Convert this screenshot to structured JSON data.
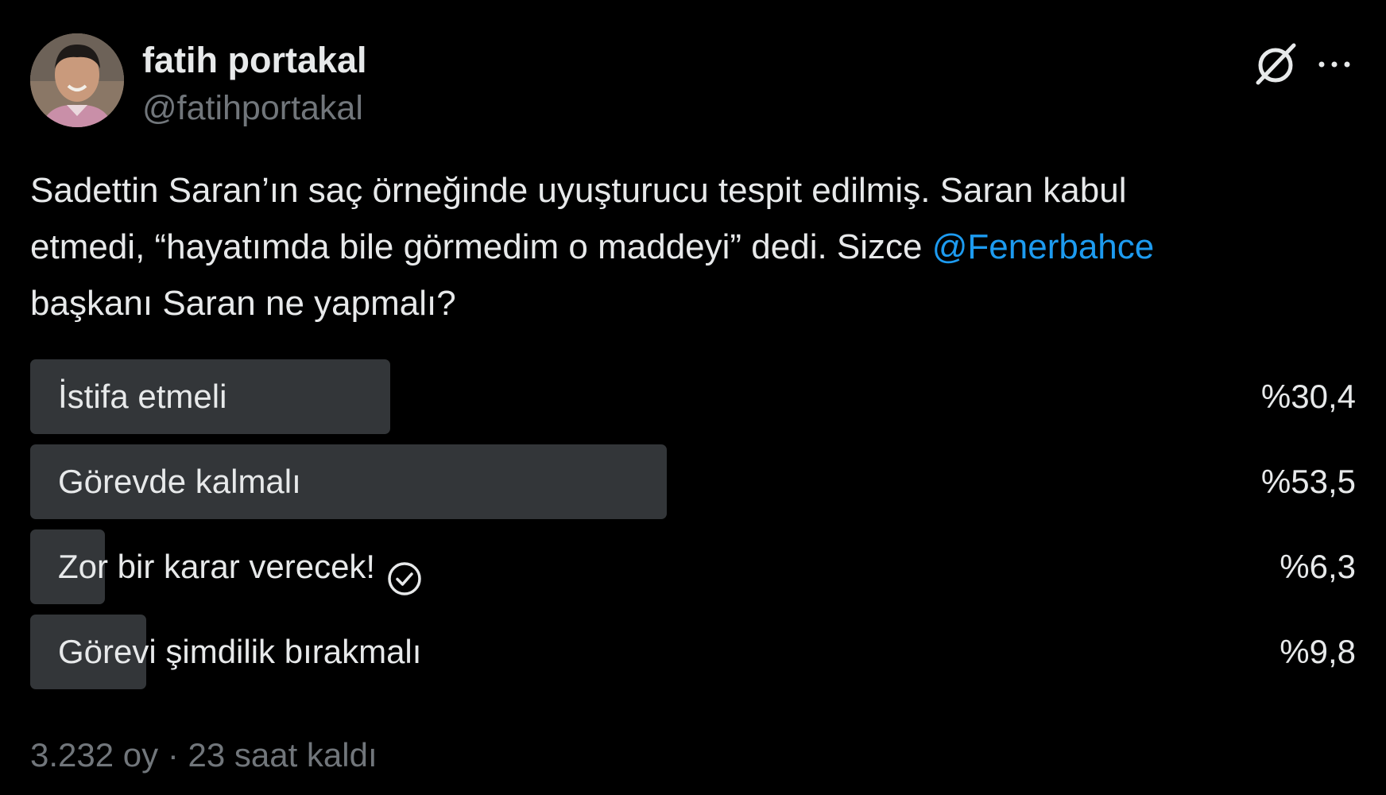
{
  "author": {
    "name": "fatih portakal",
    "handle": "@fatihportakal"
  },
  "tweet": {
    "line1": "Sadettin Saran’ın saç örneğinde uyuşturucu tespit edilmiş. Saran kabul",
    "line2_pre": "etmedi, “hayatımda bile görmedim o maddeyi” dedi. Sizce ",
    "mention": "@Fenerbahce",
    "line3": "başkanı Saran ne yapmalı?"
  },
  "poll": {
    "options": [
      {
        "label": "İstifa etmeli",
        "percent_text": "%30,4",
        "percent": 30.4,
        "voted": false
      },
      {
        "label": "Görevde kalmalı",
        "percent_text": "%53,5",
        "percent": 53.5,
        "voted": false
      },
      {
        "label": "Zor bir karar verecek!",
        "percent_text": "%6,3",
        "percent": 6.3,
        "voted": true
      },
      {
        "label": "Görevi şimdilik bırakmalı",
        "percent_text": "%9,8",
        "percent": 9.8,
        "voted": false
      }
    ],
    "votes_text": "3.232 oy",
    "separator": "·",
    "time_left_text": "23 saat kaldı"
  },
  "icons": {
    "grok": "grok-icon",
    "more": "more-icon",
    "check": "check-circle-icon"
  },
  "colors": {
    "background": "#000000",
    "text": "#e7e9ea",
    "secondary": "#71767b",
    "link": "#1d9bf0",
    "poll_bar": "#333639"
  }
}
